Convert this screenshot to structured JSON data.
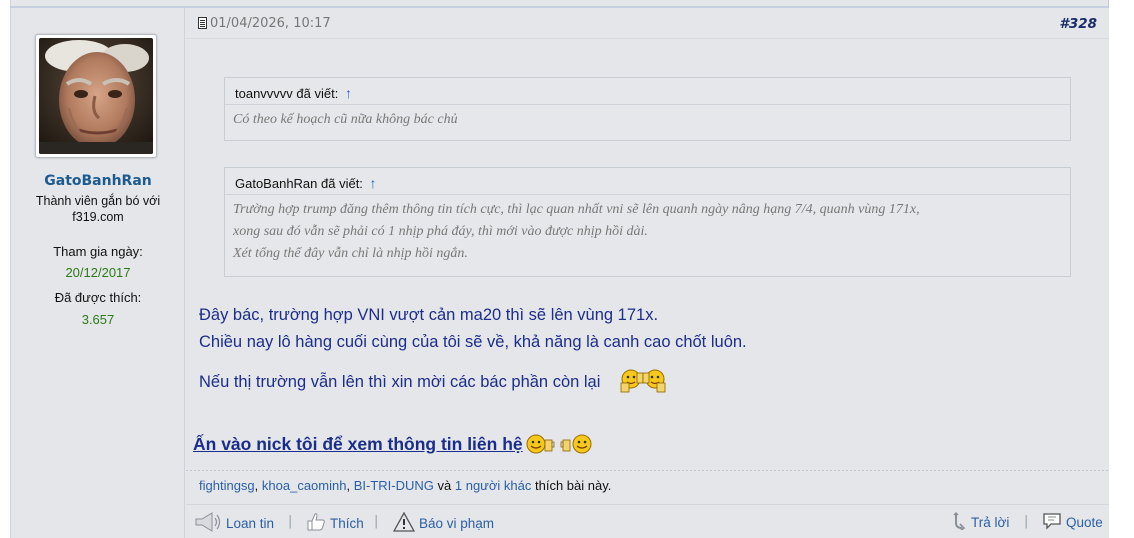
{
  "post": {
    "date": "01/04/2026, 10:17",
    "number": "#328",
    "author": {
      "username": "GatoBanhRan",
      "title_line1": "Thành viên gắn bó với",
      "title_line2": "f319.com",
      "joined_label": "Tham gia ngày:",
      "joined_value": "20/12/2017",
      "likes_label": "Đã được thích:",
      "likes_value": "3.657"
    },
    "quotes": [
      {
        "author_line": "toanvvvvv đã viết:",
        "arrow": "↑",
        "lines": [
          "Có theo kế hoạch cũ nữa không bác chủ"
        ]
      },
      {
        "author_line": "GatoBanhRan đã viết:",
        "arrow": "↑",
        "lines": [
          "Trường hợp trump đăng thêm thông tin tích cực, thì lạc quan nhất vni sẽ lên quanh ngày nâng hạng 7/4, quanh vùng 171x,",
          "xong sau đó vẫn sẽ phải có 1 nhịp phá đáy, thì mới vào được nhịp hồi dài.",
          "Xét tổng thể đây vẫn chỉ là nhịp hồi ngắn."
        ]
      }
    ],
    "message": {
      "line1": "Đây bác, trường hợp VNI vượt cản ma20 thì sẽ lên vùng 171x.",
      "line2": "Chiều nay lô hàng cuối cùng của tôi sẽ về, khả năng là canh cao chốt luôn.",
      "line3": "Nếu thị trường vẫn lên thì xin mời các bác phần còn lại"
    },
    "contact_link": "Ấn vào nick tôi để xem thông tin liên hệ",
    "likes": {
      "user1": "fightingsg",
      "user2": "khoa_caominh",
      "user3": "BI-TRI-DUNG",
      "connector": "và",
      "others": "1 người khác",
      "suffix": "thích bài này.",
      "comma": ","
    },
    "actions": {
      "report_ad": "Loan tin",
      "like": "Thích",
      "report": "Báo vi phạm",
      "reply": "Trả lời",
      "quote": "Quote",
      "separator": "|"
    }
  },
  "colors": {
    "background": "#e4e6ea",
    "username": "#1c5a8f",
    "message_text": "#1c2d8a",
    "link": "#2b5fa5",
    "stat_value": "#2b7a18"
  },
  "icons": [
    "document-icon",
    "avatar-photo",
    "megaphone-icon",
    "thumbs-up-icon",
    "warning-icon",
    "reply-icon",
    "quote-bubble-icon",
    "smiley-beer-icon"
  ]
}
